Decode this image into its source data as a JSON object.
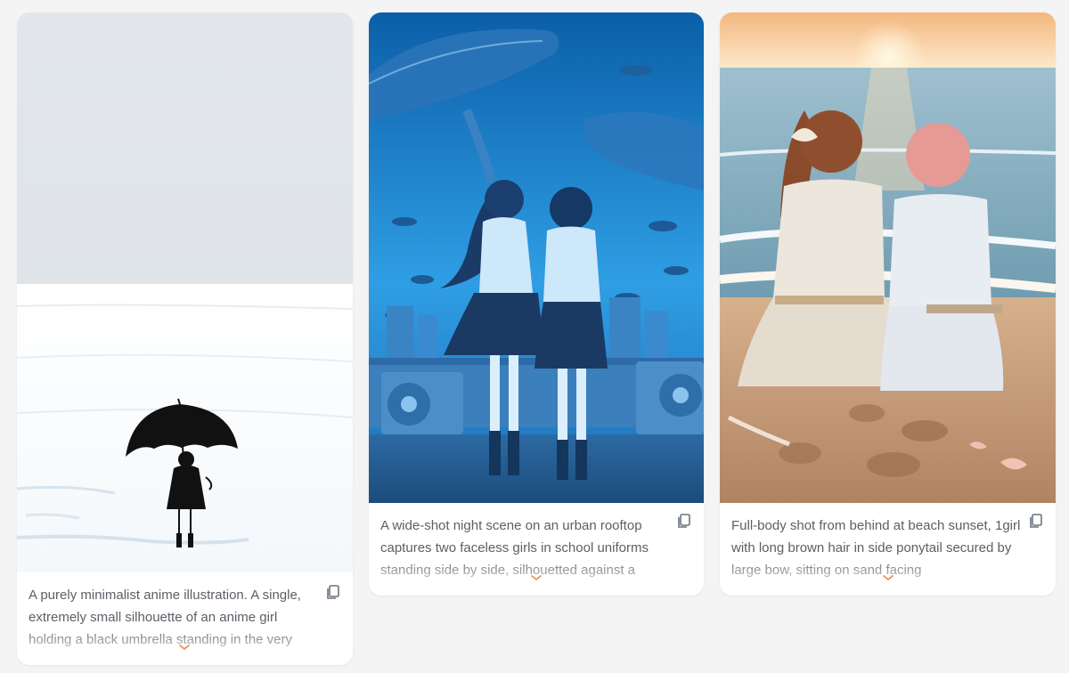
{
  "gallery": {
    "cards": [
      {
        "image_alt": "Minimalist anime illustration of a tiny girl holding a black umbrella on a white snowy plain",
        "prompt": "A purely minimalist anime illustration. A single, extremely small silhouette of an anime girl holding a black umbrella standing in the very",
        "copy_icon": "copy-icon",
        "expand_icon": "chevron-down-icon"
      },
      {
        "image_alt": "Two girls in school uniforms on a rooftop looking at a blue city sky with whales and fish",
        "prompt": "A wide-shot night scene on an urban rooftop captures two faceless girls in school uniforms standing side by side, silhouetted against a",
        "copy_icon": "copy-icon",
        "expand_icon": "chevron-down-icon"
      },
      {
        "image_alt": "Two girls sitting on the sand at a beach sunset seen from behind",
        "prompt": "Full-body shot from behind at beach sunset, 1girl with long brown hair in side ponytail secured by large bow, sitting on sand facing",
        "copy_icon": "copy-icon",
        "expand_icon": "chevron-down-icon"
      }
    ]
  },
  "colors": {
    "page_background": "#f4f4f5",
    "card_background": "#ffffff",
    "prompt_text": "#5b5f66",
    "icon": "#6b7280",
    "expand_chevron": "#e9956a"
  }
}
